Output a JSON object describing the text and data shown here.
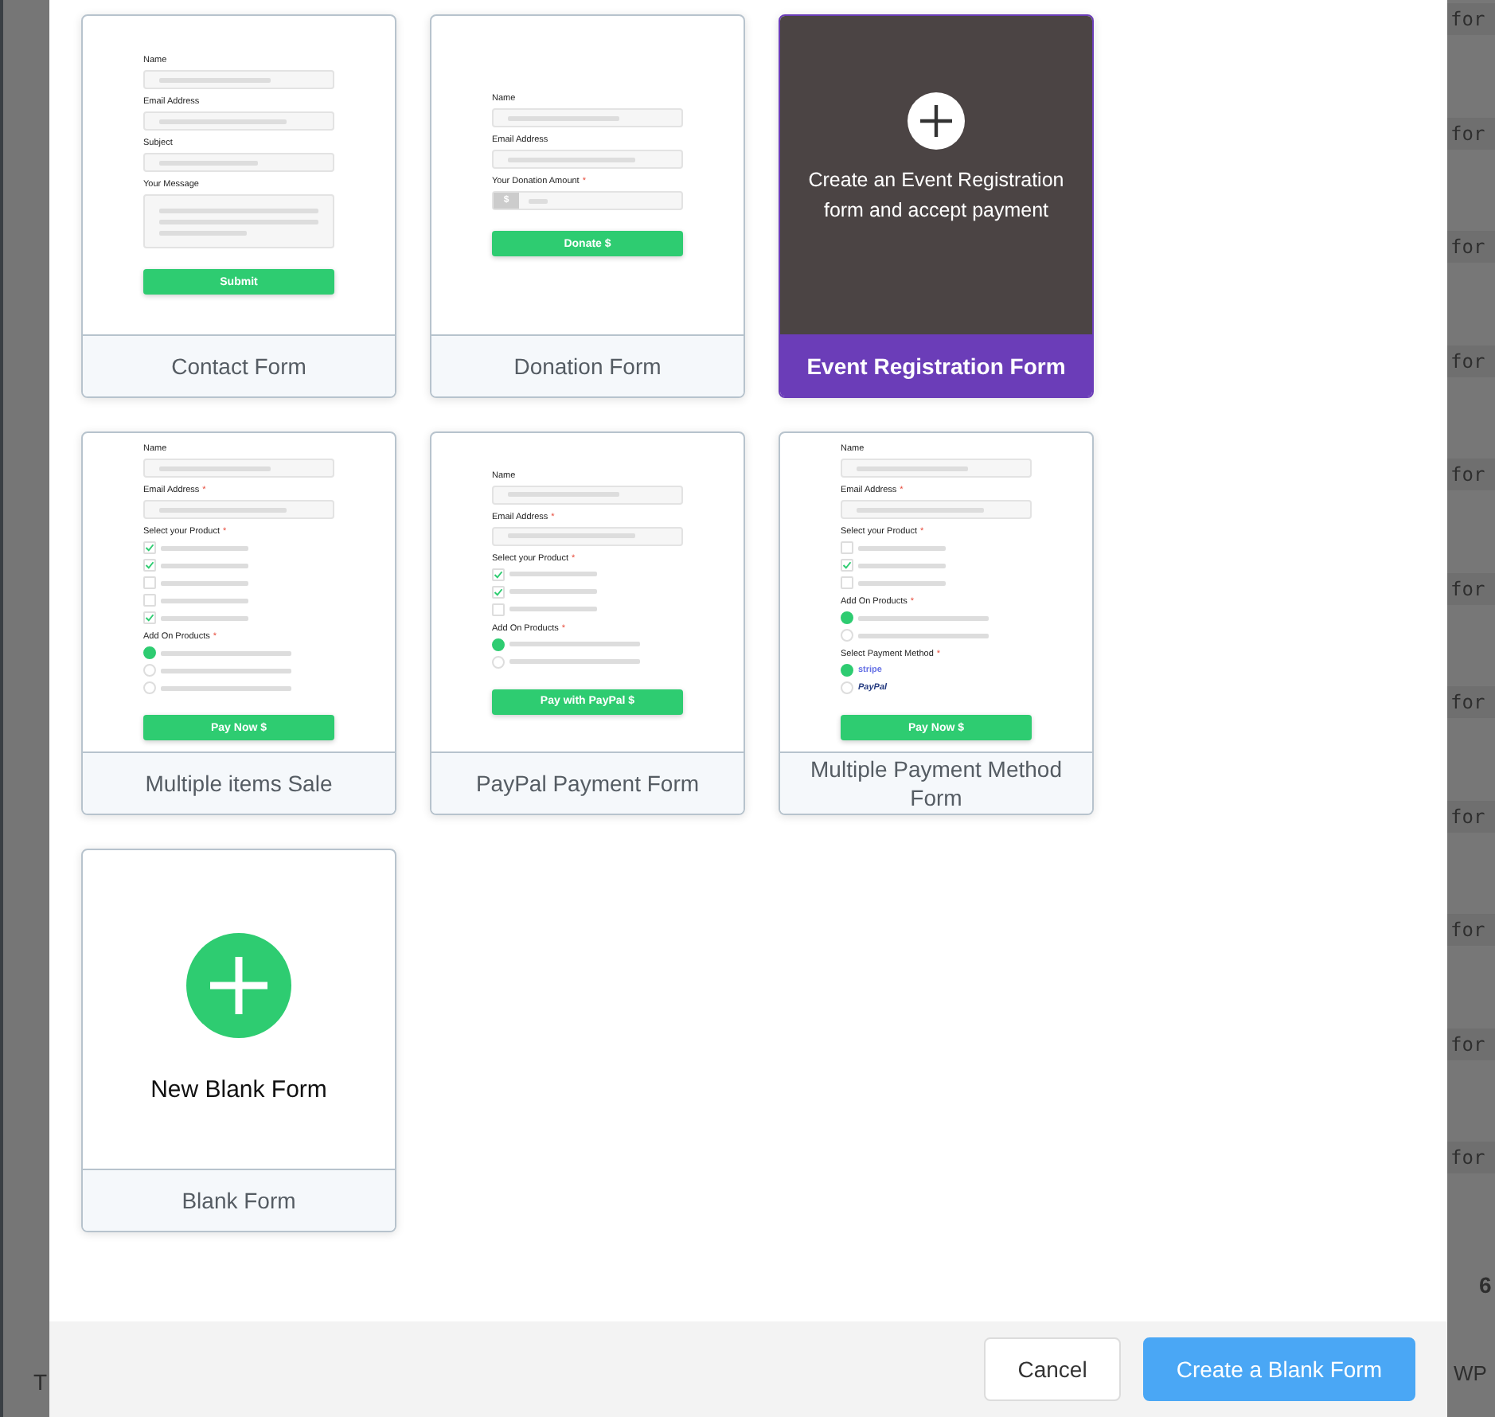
{
  "background": {
    "right_column": [
      "for",
      "for",
      "for",
      "for",
      "for",
      "for",
      "for",
      "for",
      "for",
      "for",
      "for"
    ],
    "right_footer": [
      "6",
      "WP"
    ],
    "left_footer": "T"
  },
  "templates": [
    {
      "title": "Contact Form",
      "hovered": false,
      "preview": [
        {
          "kind": "field",
          "label": "Name"
        },
        {
          "kind": "field",
          "label": "Email Address"
        },
        {
          "kind": "field",
          "label": "Subject"
        },
        {
          "kind": "textarea",
          "label": "Your Message"
        },
        {
          "kind": "button",
          "label": "Submit"
        }
      ]
    },
    {
      "title": "Donation Form",
      "hovered": false,
      "preview": [
        {
          "kind": "field",
          "label": "Name"
        },
        {
          "kind": "field",
          "label": "Email Address"
        },
        {
          "kind": "amount",
          "label": "Your Donation Amount",
          "required_mark": "*",
          "prefix": "$"
        },
        {
          "kind": "button",
          "label": "Donate $"
        }
      ]
    },
    {
      "title": "Event Registration Form",
      "hovered": true,
      "overlay_text": "Create an Event Registration form and accept payment"
    },
    {
      "title": "Multiple items Sale",
      "hovered": false,
      "preview": [
        {
          "kind": "field",
          "label": "Name"
        },
        {
          "kind": "field",
          "label": "Email Address",
          "required_mark": "*"
        },
        {
          "kind": "checkboxes",
          "label": "Select your Product",
          "required_mark": "*",
          "options": [
            {
              "checked": true
            },
            {
              "checked": true
            },
            {
              "checked": false
            },
            {
              "checked": false
            },
            {
              "checked": true
            }
          ]
        },
        {
          "kind": "radios",
          "label": "Add On Products",
          "required_mark": "*",
          "options": [
            {
              "selected": true
            },
            {
              "selected": false
            },
            {
              "selected": false
            }
          ]
        },
        {
          "kind": "button",
          "label": "Pay Now $"
        }
      ]
    },
    {
      "title": "PayPal Payment Form",
      "hovered": false,
      "preview": [
        {
          "kind": "field",
          "label": "Name"
        },
        {
          "kind": "field",
          "label": "Email Address",
          "required_mark": "*"
        },
        {
          "kind": "checkboxes",
          "label": "Select your Product",
          "required_mark": "*",
          "options": [
            {
              "checked": true
            },
            {
              "checked": true
            },
            {
              "checked": false
            }
          ]
        },
        {
          "kind": "radios",
          "label": "Add On Products",
          "required_mark": "*",
          "options": [
            {
              "selected": true
            },
            {
              "selected": false
            }
          ]
        },
        {
          "kind": "button",
          "label": "Pay with PayPal $"
        }
      ]
    },
    {
      "title": "Multiple Payment Method Form",
      "hovered": false,
      "preview": [
        {
          "kind": "field",
          "label": "Name"
        },
        {
          "kind": "field",
          "label": "Email Address",
          "required_mark": "*"
        },
        {
          "kind": "checkboxes",
          "label": "Select your Product",
          "required_mark": "*",
          "options": [
            {
              "checked": false
            },
            {
              "checked": true
            },
            {
              "checked": false
            }
          ]
        },
        {
          "kind": "radios",
          "label": "Add On Products",
          "required_mark": "*",
          "options": [
            {
              "selected": true
            },
            {
              "selected": false
            }
          ]
        },
        {
          "kind": "payment",
          "label": "Select Payment Method",
          "required_mark": "*",
          "options": [
            {
              "selected": true,
              "name": "stripe"
            },
            {
              "selected": false,
              "name": "PayPal"
            }
          ]
        },
        {
          "kind": "button",
          "label": "Pay Now $"
        }
      ]
    }
  ],
  "blank": {
    "label": "New Blank Form",
    "title": "Blank Form"
  },
  "footer": {
    "buttons": [
      {
        "label": "Cancel",
        "kind": "secondary"
      },
      {
        "label": "Create a Blank Form",
        "kind": "primary"
      }
    ]
  }
}
